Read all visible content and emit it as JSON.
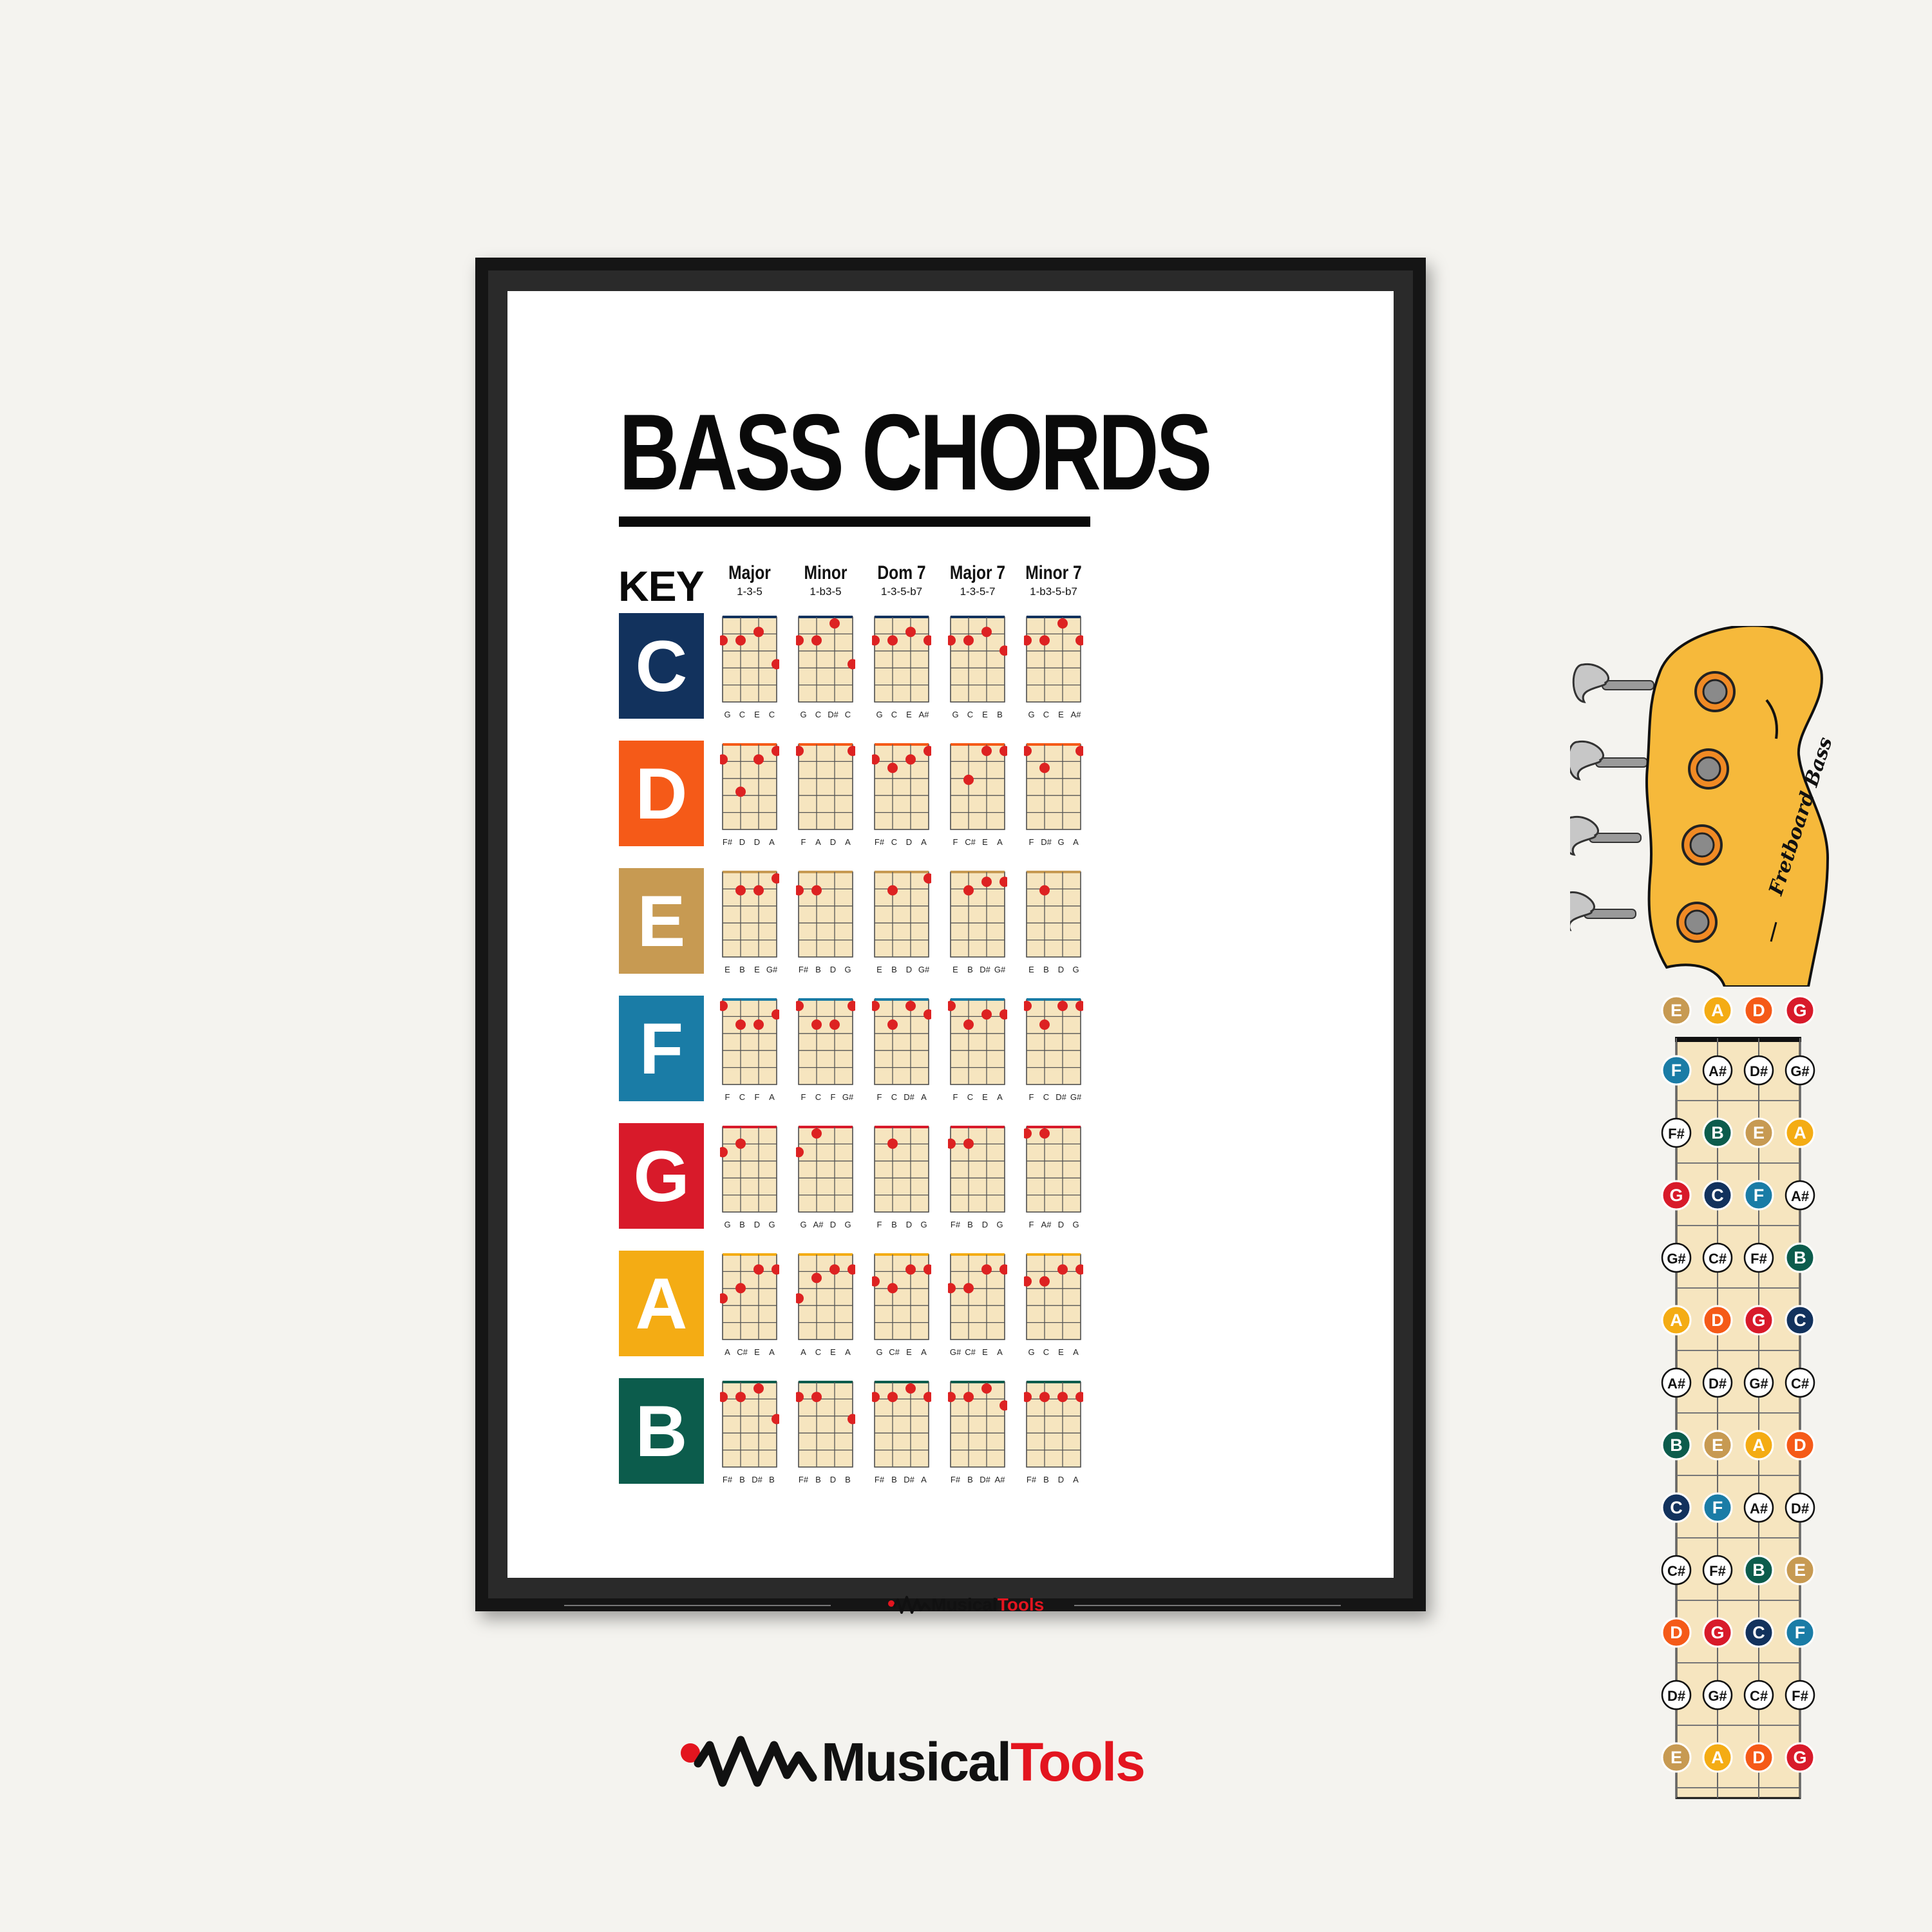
{
  "poster": {
    "title": "BASS CHORDS",
    "key_label": "KEY",
    "headstock_label": "Fretboard Bass",
    "footer_logo": {
      "part1": "Musical",
      "part2": "Tools"
    }
  },
  "brand_logo": {
    "part1": "Musical",
    "part2": "Tools"
  },
  "colors": {
    "C": "#12325d",
    "D": "#f55a18",
    "E": "#c79a52",
    "F": "#1a7ca6",
    "G": "#d81a2a",
    "A": "#f4ac14",
    "B": "#0c5c4c",
    "fretboard": "#f6e5bf",
    "dot": "#dd2222",
    "accent": "#e3151f"
  },
  "columns": [
    {
      "name": "Major",
      "formula": "1-3-5"
    },
    {
      "name": "Minor",
      "formula": "1-b3-5"
    },
    {
      "name": "Dom 7",
      "formula": "1-3-5-b7"
    },
    {
      "name": "Major 7",
      "formula": "1-3-5-7"
    },
    {
      "name": "Minor 7",
      "formula": "1-b3-5-b7"
    }
  ],
  "keys": [
    {
      "key": "C",
      "chords": [
        {
          "notes": [
            "G",
            "C",
            "E",
            "C"
          ],
          "dots": [
            [
              0,
              1
            ],
            [
              1,
              1
            ],
            [
              2,
              0.5
            ],
            [
              3,
              2.4
            ]
          ]
        },
        {
          "notes": [
            "G",
            "C",
            "D#",
            "C"
          ],
          "dots": [
            [
              0,
              1
            ],
            [
              1,
              1
            ],
            [
              2,
              0
            ],
            [
              3,
              2.4
            ]
          ]
        },
        {
          "notes": [
            "G",
            "C",
            "E",
            "A#"
          ],
          "dots": [
            [
              0,
              1
            ],
            [
              1,
              1
            ],
            [
              2,
              0.5
            ],
            [
              3,
              1
            ]
          ]
        },
        {
          "notes": [
            "G",
            "C",
            "E",
            "B"
          ],
          "dots": [
            [
              0,
              1
            ],
            [
              1,
              1
            ],
            [
              2,
              0.5
            ],
            [
              3,
              1.6
            ]
          ]
        },
        {
          "notes": [
            "G",
            "C",
            "E",
            "A#"
          ],
          "dots": [
            [
              0,
              1
            ],
            [
              1,
              1
            ],
            [
              2,
              0
            ],
            [
              3,
              1
            ]
          ]
        }
      ]
    },
    {
      "key": "D",
      "chords": [
        {
          "notes": [
            "F#",
            "D",
            "D",
            "A"
          ],
          "dots": [
            [
              0,
              0.5
            ],
            [
              1,
              2.4
            ],
            [
              2,
              0.5
            ],
            [
              3,
              0
            ]
          ]
        },
        {
          "notes": [
            "F",
            "A",
            "D",
            "A"
          ],
          "dots": [
            [
              0,
              0
            ],
            [
              3,
              0
            ]
          ]
        },
        {
          "notes": [
            "F#",
            "C",
            "D",
            "A"
          ],
          "dots": [
            [
              0,
              0.5
            ],
            [
              1,
              1
            ],
            [
              2,
              0.5
            ],
            [
              3,
              0
            ]
          ]
        },
        {
          "notes": [
            "F",
            "C#",
            "E",
            "A"
          ],
          "dots": [
            [
              1,
              1.7
            ],
            [
              2,
              0
            ],
            [
              3,
              0
            ]
          ]
        },
        {
          "notes": [
            "F",
            "D#",
            "G",
            "A"
          ],
          "dots": [
            [
              0,
              0
            ],
            [
              1,
              1
            ],
            [
              3,
              0
            ]
          ]
        }
      ]
    },
    {
      "key": "E",
      "chords": [
        {
          "notes": [
            "E",
            "B",
            "E",
            "G#"
          ],
          "dots": [
            [
              1,
              0.7
            ],
            [
              2,
              0.7
            ],
            [
              3,
              0
            ]
          ]
        },
        {
          "notes": [
            "F#",
            "B",
            "D",
            "G"
          ],
          "dots": [
            [
              0,
              0.7
            ],
            [
              1,
              0.7
            ]
          ]
        },
        {
          "notes": [
            "E",
            "B",
            "D",
            "G#"
          ],
          "dots": [
            [
              1,
              0.7
            ],
            [
              3,
              0
            ]
          ]
        },
        {
          "notes": [
            "E",
            "B",
            "D#",
            "G#"
          ],
          "dots": [
            [
              1,
              0.7
            ],
            [
              2,
              0.2
            ],
            [
              3,
              0.2
            ]
          ]
        },
        {
          "notes": [
            "E",
            "B",
            "D",
            "G"
          ],
          "dots": [
            [
              1,
              0.7
            ]
          ]
        }
      ]
    },
    {
      "key": "F",
      "chords": [
        {
          "notes": [
            "F",
            "C",
            "F",
            "A"
          ],
          "dots": [
            [
              0,
              0
            ],
            [
              1,
              1.1
            ],
            [
              2,
              1.1
            ],
            [
              3,
              0.5
            ]
          ]
        },
        {
          "notes": [
            "F",
            "C",
            "F",
            "G#"
          ],
          "dots": [
            [
              0,
              0
            ],
            [
              1,
              1.1
            ],
            [
              2,
              1.1
            ],
            [
              3,
              0
            ]
          ]
        },
        {
          "notes": [
            "F",
            "C",
            "D#",
            "A"
          ],
          "dots": [
            [
              0,
              0
            ],
            [
              1,
              1.1
            ],
            [
              2,
              0
            ],
            [
              3,
              0.5
            ]
          ]
        },
        {
          "notes": [
            "F",
            "C",
            "E",
            "A"
          ],
          "dots": [
            [
              0,
              0
            ],
            [
              1,
              1.1
            ],
            [
              2,
              0.5
            ],
            [
              3,
              0.5
            ]
          ]
        },
        {
          "notes": [
            "F",
            "C",
            "D#",
            "G#"
          ],
          "dots": [
            [
              0,
              0
            ],
            [
              1,
              1.1
            ],
            [
              2,
              0
            ],
            [
              3,
              0
            ]
          ]
        }
      ]
    },
    {
      "key": "G",
      "chords": [
        {
          "notes": [
            "G",
            "B",
            "D",
            "G"
          ],
          "dots": [
            [
              0,
              1.1
            ],
            [
              1,
              0.6
            ]
          ]
        },
        {
          "notes": [
            "G",
            "A#",
            "D",
            "G"
          ],
          "dots": [
            [
              0,
              1.1
            ],
            [
              1,
              0
            ]
          ]
        },
        {
          "notes": [
            "F",
            "B",
            "D",
            "G"
          ],
          "dots": [
            [
              1,
              0.6
            ]
          ]
        },
        {
          "notes": [
            "F#",
            "B",
            "D",
            "G"
          ],
          "dots": [
            [
              0,
              0.6
            ],
            [
              1,
              0.6
            ]
          ]
        },
        {
          "notes": [
            "F",
            "A#",
            "D",
            "G"
          ],
          "dots": [
            [
              0,
              0
            ],
            [
              1,
              0
            ]
          ]
        }
      ]
    },
    {
      "key": "A",
      "chords": [
        {
          "notes": [
            "A",
            "C#",
            "E",
            "A"
          ],
          "dots": [
            [
              0,
              2.2
            ],
            [
              1,
              1.6
            ],
            [
              2,
              0.5
            ],
            [
              3,
              0.5
            ]
          ]
        },
        {
          "notes": [
            "A",
            "C",
            "E",
            "A"
          ],
          "dots": [
            [
              0,
              2.2
            ],
            [
              1,
              1
            ],
            [
              2,
              0.5
            ],
            [
              3,
              0.5
            ]
          ]
        },
        {
          "notes": [
            "G",
            "C#",
            "E",
            "A"
          ],
          "dots": [
            [
              0,
              1.2
            ],
            [
              1,
              1.6
            ],
            [
              2,
              0.5
            ],
            [
              3,
              0.5
            ]
          ]
        },
        {
          "notes": [
            "G#",
            "C#",
            "E",
            "A"
          ],
          "dots": [
            [
              0,
              1.6
            ],
            [
              1,
              1.6
            ],
            [
              2,
              0.5
            ],
            [
              3,
              0.5
            ]
          ]
        },
        {
          "notes": [
            "G",
            "C",
            "E",
            "A"
          ],
          "dots": [
            [
              0,
              1.2
            ],
            [
              1,
              1.2
            ],
            [
              2,
              0.5
            ],
            [
              3,
              0.5
            ]
          ]
        }
      ]
    },
    {
      "key": "B",
      "chords": [
        {
          "notes": [
            "F#",
            "B",
            "D#",
            "B"
          ],
          "dots": [
            [
              0,
              0.5
            ],
            [
              1,
              0.5
            ],
            [
              2,
              0
            ],
            [
              3,
              1.8
            ]
          ]
        },
        {
          "notes": [
            "F#",
            "B",
            "D",
            "B"
          ],
          "dots": [
            [
              0,
              0.5
            ],
            [
              1,
              0.5
            ],
            [
              3,
              1.8
            ]
          ]
        },
        {
          "notes": [
            "F#",
            "B",
            "D#",
            "A"
          ],
          "dots": [
            [
              0,
              0.5
            ],
            [
              1,
              0.5
            ],
            [
              2,
              0
            ],
            [
              3,
              0.5
            ]
          ]
        },
        {
          "notes": [
            "F#",
            "B",
            "D#",
            "A#"
          ],
          "dots": [
            [
              0,
              0.5
            ],
            [
              1,
              0.5
            ],
            [
              2,
              0
            ],
            [
              3,
              1
            ]
          ]
        },
        {
          "notes": [
            "F#",
            "B",
            "D",
            "A"
          ],
          "dots": [
            [
              0,
              0.5
            ],
            [
              1,
              0.5
            ],
            [
              2,
              0.5
            ],
            [
              3,
              0.5
            ]
          ]
        }
      ]
    }
  ],
  "fretboard": {
    "open_strings": [
      "E",
      "A",
      "D",
      "G"
    ],
    "frets": [
      [
        "F",
        "A#",
        "D#",
        "G#"
      ],
      [
        "F#",
        "B",
        "E",
        "A"
      ],
      [
        "G",
        "C",
        "F",
        "A#"
      ],
      [
        "G#",
        "C#",
        "F#",
        "B"
      ],
      [
        "A",
        "D",
        "G",
        "C"
      ],
      [
        "A#",
        "D#",
        "G#",
        "C#"
      ],
      [
        "B",
        "E",
        "A",
        "D"
      ],
      [
        "C",
        "F",
        "A#",
        "D#"
      ],
      [
        "C#",
        "F#",
        "B",
        "E"
      ],
      [
        "D",
        "G",
        "C",
        "F"
      ],
      [
        "D#",
        "G#",
        "C#",
        "F#"
      ],
      [
        "E",
        "A",
        "D",
        "G"
      ]
    ]
  }
}
